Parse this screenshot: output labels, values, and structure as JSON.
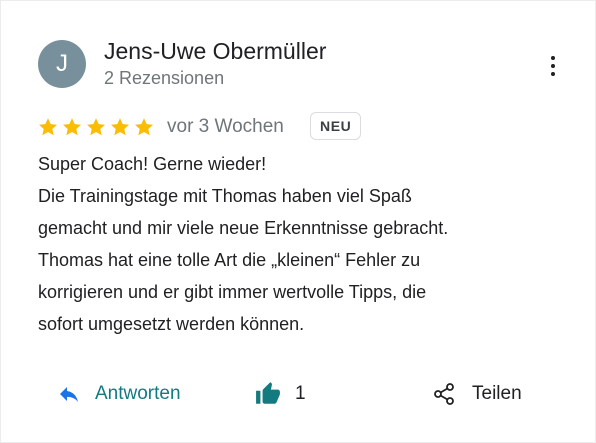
{
  "reviewer": {
    "initial": "J",
    "name": "Jens-Uwe Obermüller",
    "review_count": "2 Rezensionen",
    "avatar_color": "#78909c"
  },
  "rating": {
    "stars": 5,
    "max_stars": 5,
    "star_color": "#fbbc04"
  },
  "meta": {
    "time_ago": "vor 3 Wochen",
    "badge": "NEU"
  },
  "review": {
    "lines": [
      "Super Coach! Gerne wieder!",
      "Die Trainingstage mit Thomas haben viel Spaß",
      "gemacht und mir viele neue Erkenntnisse gebracht.",
      "Thomas hat eine tolle Art die „kleinen“ Fehler zu",
      "korrigieren und er gibt immer wertvolle Tipps, die",
      "sofort umgesetzt werden können."
    ]
  },
  "actions": {
    "reply": {
      "label": "Antworten",
      "icon": "reply-icon",
      "color": "#137a7f"
    },
    "like": {
      "count": "1",
      "icon": "thumbs-up-icon",
      "color": "#137a7f"
    },
    "share": {
      "label": "Teilen",
      "icon": "share-icon"
    }
  },
  "menu": {
    "icon": "more-vert-icon"
  }
}
